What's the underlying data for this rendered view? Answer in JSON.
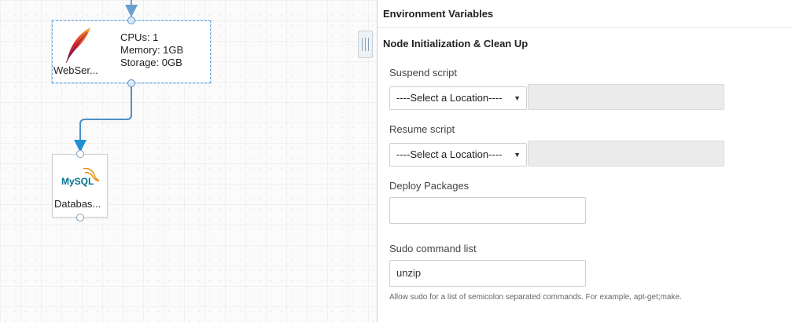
{
  "canvas": {
    "web_node": {
      "name": "WebSer...",
      "icon": "apache-feather-icon",
      "cpus": "CPUs: 1",
      "memory": "Memory: 1GB",
      "storage": "Storage: 0GB"
    },
    "db_node": {
      "name": "Databas...",
      "icon": "mysql-logo-icon",
      "logo_text": "MySQL"
    },
    "colors": {
      "connector": "#4a90c8",
      "selection": "#6ba6dc"
    }
  },
  "panel": {
    "env_section_title": "Environment Variables",
    "node_section_title": "Node Initialization & Clean Up",
    "suspend_label": "Suspend script",
    "suspend_select": "----Select a Location----",
    "resume_label": "Resume script",
    "resume_select": "----Select a Location----",
    "deploy_label": "Deploy Packages",
    "deploy_value": "",
    "sudo_label": "Sudo command list",
    "sudo_value": "unzip",
    "sudo_help": "Allow sudo for a list of semicolon separated commands. For example, apt-get;make."
  }
}
